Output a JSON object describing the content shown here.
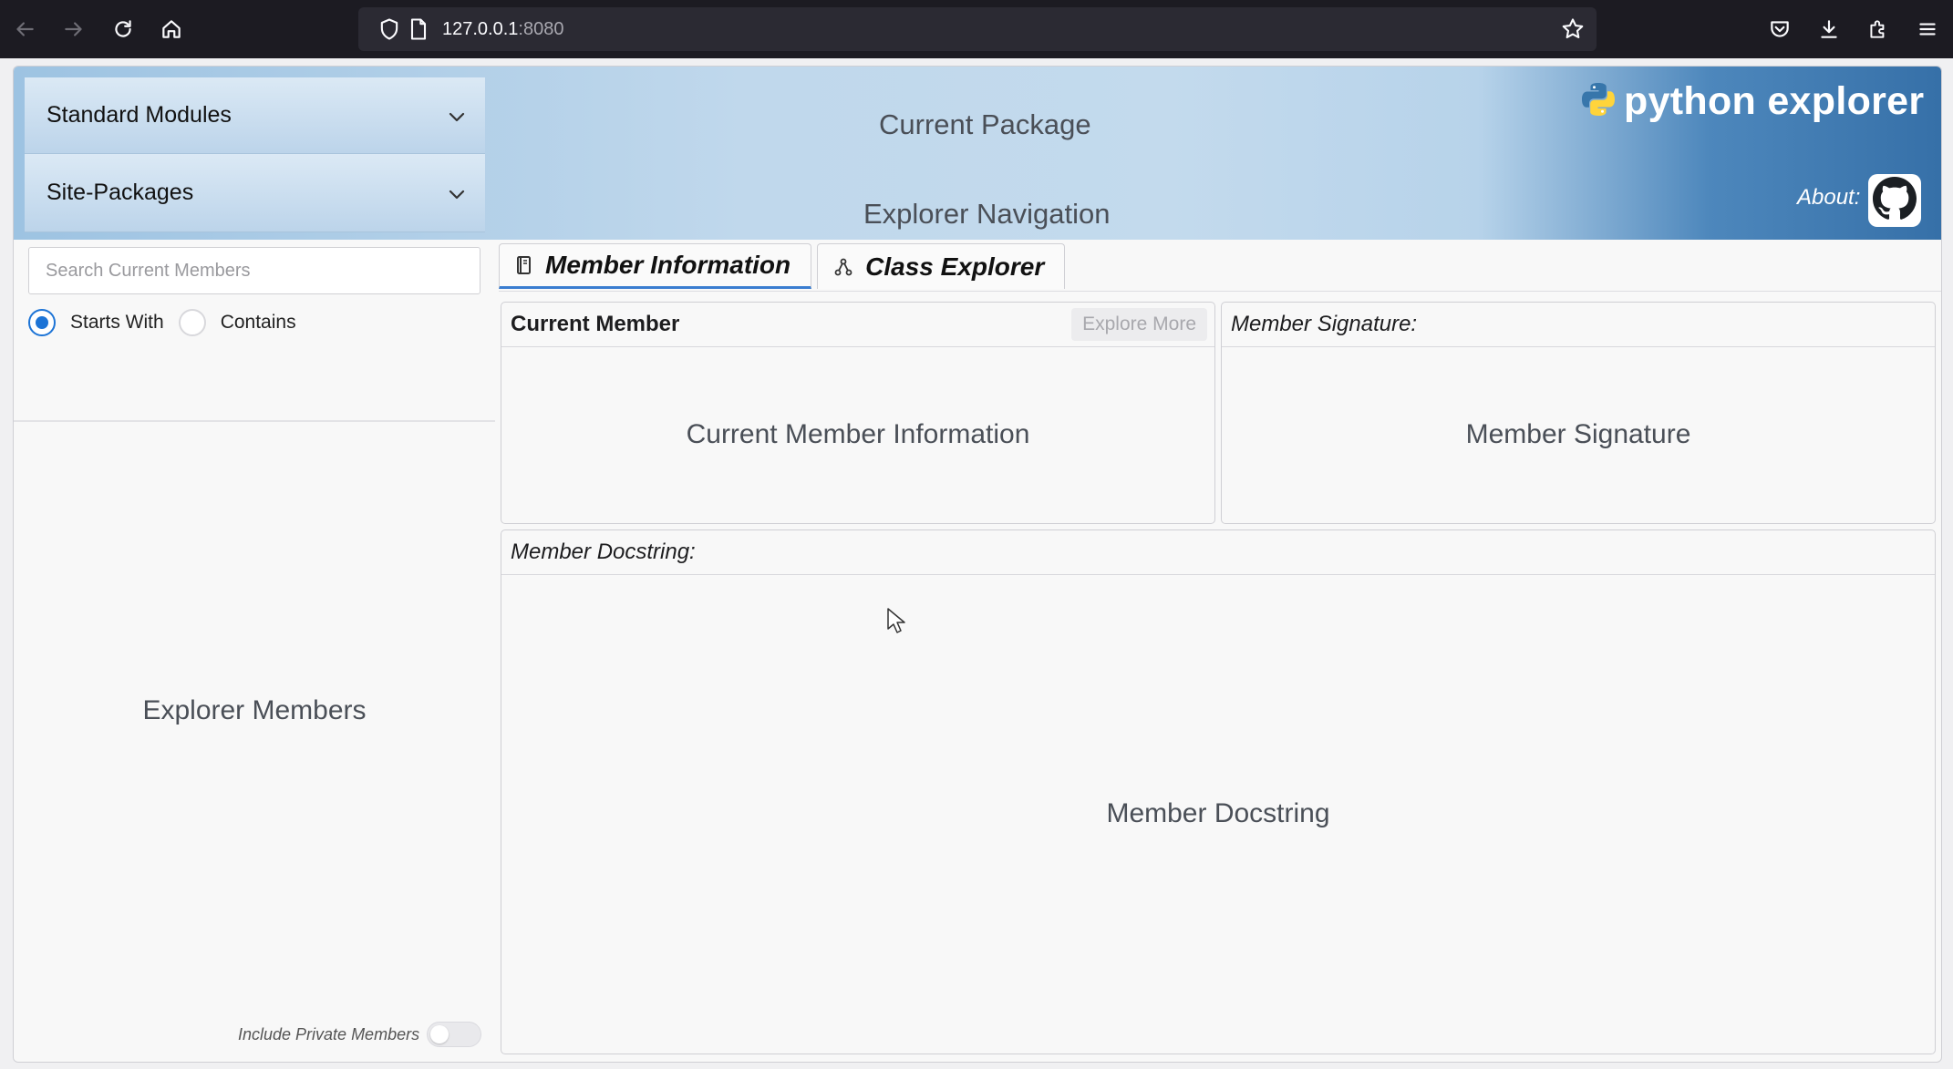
{
  "browser": {
    "url_host": "127.0.0.1",
    "url_port": ":8080"
  },
  "sidebar": {
    "accordion": [
      {
        "label": "Standard Modules"
      },
      {
        "label": "Site-Packages"
      }
    ],
    "search": {
      "placeholder": "Search Current Members"
    },
    "match_mode": {
      "options": [
        {
          "label": "Starts With",
          "selected": true
        },
        {
          "label": "Contains",
          "selected": false
        }
      ]
    },
    "members_placeholder": "Explorer Members",
    "private_toggle": {
      "label": "Include Private Members",
      "on": false
    }
  },
  "header": {
    "current_package": "Current Package",
    "navigation": "Explorer Navigation",
    "brand": "python explorer",
    "about_label": "About:"
  },
  "tabs": [
    {
      "label": "Member Information",
      "active": true
    },
    {
      "label": "Class Explorer",
      "active": false
    }
  ],
  "panels": {
    "current_member": {
      "title": "Current Member",
      "button": "Explore More",
      "body": "Current Member Information"
    },
    "signature": {
      "title": "Member Signature:",
      "body": "Member Signature"
    },
    "docstring": {
      "title": "Member Docstring:",
      "body": "Member Docstring"
    }
  },
  "colors": {
    "accent": "#1d74d6",
    "header_gradient_end": "#3670a8",
    "chrome_bg": "#1c1b22"
  }
}
